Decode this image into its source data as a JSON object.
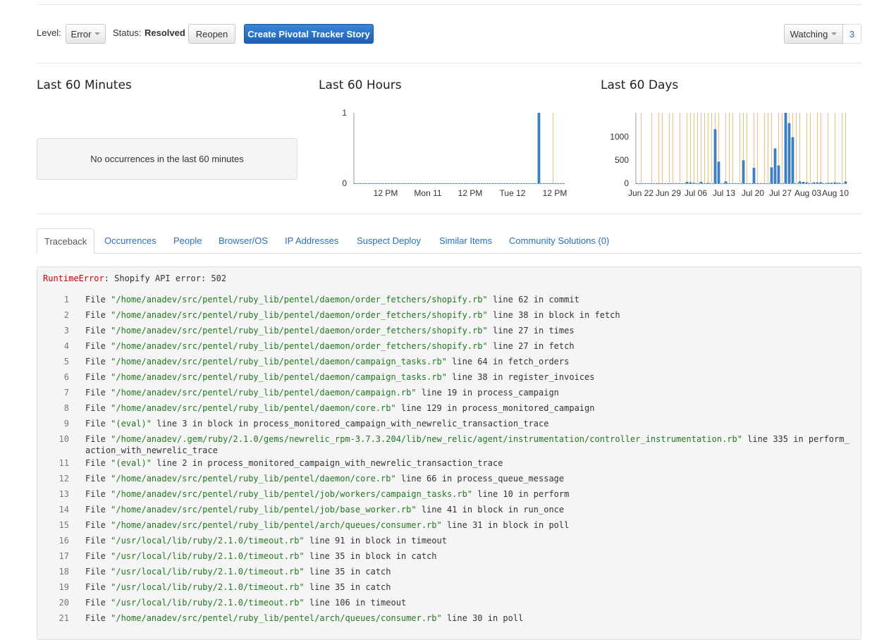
{
  "toolbar": {
    "level_label": "Level:",
    "level_value": "Error",
    "status_label": "Status:",
    "status_value": "Resolved",
    "reopen_label": "Reopen",
    "pivotal_label": "Create Pivotal Tracker Story",
    "watching_label": "Watching",
    "watch_count": "3"
  },
  "charts": {
    "minutes": {
      "title": "Last 60 Minutes",
      "empty_text": "No occurrences in the last 60 minutes"
    },
    "hours": {
      "title": "Last 60 Hours",
      "y_ticks": [
        "1",
        "0"
      ],
      "x_ticks": [
        "12 PM",
        "Mon 11",
        "12 PM",
        "Tue 12",
        "12 PM"
      ]
    },
    "days": {
      "title": "Last 60 Days",
      "y_ticks": [
        "1000",
        "500",
        "0"
      ],
      "x_ticks": [
        "Jun 22",
        "Jun 29",
        "Jul 06",
        "Jul 13",
        "Jul 20",
        "Jul 27",
        "Aug 03",
        "Aug 10"
      ]
    }
  },
  "chart_data": [
    {
      "type": "bar",
      "title": "Last 60 Hours",
      "series": [
        {
          "values": [
            0,
            0,
            0,
            0,
            0,
            0,
            0,
            0,
            0,
            0,
            0,
            0,
            0,
            0,
            0,
            0,
            0,
            0,
            0,
            0,
            0,
            0,
            0,
            0,
            0,
            0,
            0,
            0,
            0,
            0,
            0,
            0,
            0,
            0,
            0,
            0,
            0,
            0,
            0,
            0,
            0,
            0,
            0,
            0,
            0,
            0,
            0,
            0,
            0,
            0,
            0,
            0,
            1,
            0,
            0,
            0,
            0,
            0,
            0,
            0
          ]
        }
      ],
      "ylim": [
        0,
        1
      ],
      "deploy_marker_index": 56,
      "bar_color": "#3f7fbf",
      "marker_color": "#f0c27a"
    },
    {
      "type": "bar",
      "title": "Last 60 Days",
      "x_start": "Jun 20",
      "series": [
        {
          "values": [
            0,
            0,
            0,
            0,
            0,
            0,
            0,
            0,
            0,
            0,
            0,
            0,
            0,
            0,
            30,
            20,
            10,
            0,
            30,
            0,
            10,
            0,
            1150,
            460,
            0,
            40,
            0,
            0,
            0,
            0,
            490,
            0,
            0,
            330,
            0,
            0,
            0,
            0,
            340,
            740,
            380,
            0,
            1550,
            1280,
            980,
            0,
            40,
            30,
            20,
            0,
            20,
            20,
            20,
            0,
            10,
            10,
            20,
            10,
            0,
            40
          ]
        }
      ],
      "ylim": [
        0,
        1500
      ],
      "deploy_marker_indices": [
        1,
        4,
        6,
        7,
        9,
        10,
        12,
        14,
        15,
        16,
        17,
        18,
        19,
        20,
        21,
        22,
        23,
        25,
        26,
        27,
        29,
        30,
        31,
        33,
        34,
        36,
        37,
        38,
        40,
        41,
        42,
        43,
        44,
        45,
        46,
        48,
        49,
        51,
        52,
        54,
        56,
        58,
        59
      ],
      "bar_color": "#3f7fbf",
      "marker_color": "#f0c27a"
    }
  ],
  "tabs": [
    {
      "label": "Traceback",
      "active": true
    },
    {
      "label": "Occurrences"
    },
    {
      "label": "People"
    },
    {
      "label": "Browser/OS"
    },
    {
      "label": "IP Addresses"
    },
    {
      "label": "Suspect Deploy"
    },
    {
      "label": "Similar Items"
    },
    {
      "label": "Community Solutions (0)"
    }
  ],
  "traceback": {
    "error_type": "RuntimeError",
    "error_message": ": Shopify API error: 502",
    "frames": [
      {
        "num": "1",
        "path": "\"/home/anadev/src/pentel/ruby_lib/pentel/daemon/order_fetchers/shopify.rb\"",
        "rest": " line 62 in commit"
      },
      {
        "num": "2",
        "path": "\"/home/anadev/src/pentel/ruby_lib/pentel/daemon/order_fetchers/shopify.rb\"",
        "rest": " line 38 in block in fetch"
      },
      {
        "num": "3",
        "path": "\"/home/anadev/src/pentel/ruby_lib/pentel/daemon/order_fetchers/shopify.rb\"",
        "rest": " line 27 in times"
      },
      {
        "num": "4",
        "path": "\"/home/anadev/src/pentel/ruby_lib/pentel/daemon/order_fetchers/shopify.rb\"",
        "rest": " line 27 in fetch"
      },
      {
        "num": "5",
        "path": "\"/home/anadev/src/pentel/ruby_lib/pentel/daemon/campaign_tasks.rb\"",
        "rest": " line 64 in fetch_orders"
      },
      {
        "num": "6",
        "path": "\"/home/anadev/src/pentel/ruby_lib/pentel/daemon/campaign_tasks.rb\"",
        "rest": " line 38 in register_invoices"
      },
      {
        "num": "7",
        "path": "\"/home/anadev/src/pentel/ruby_lib/pentel/daemon/campaign.rb\"",
        "rest": " line 19 in process_campaign"
      },
      {
        "num": "8",
        "path": "\"/home/anadev/src/pentel/ruby_lib/pentel/daemon/core.rb\"",
        "rest": " line 129 in process_monitored_campaign"
      },
      {
        "num": "9",
        "path": "\"(eval)\"",
        "rest": " line 3 in block in process_monitored_campaign_with_newrelic_transaction_trace"
      },
      {
        "num": "10",
        "path": "\"/home/anadev/.gem/ruby/2.1.0/gems/newrelic_rpm-3.7.3.204/lib/new_relic/agent/instrumentation/controller_instrumentation.rb\"",
        "rest": " line 335 in perform_action_with_newrelic_trace"
      },
      {
        "num": "11",
        "path": "\"(eval)\"",
        "rest": " line 2 in process_monitored_campaign_with_newrelic_transaction_trace"
      },
      {
        "num": "12",
        "path": "\"/home/anadev/src/pentel/ruby_lib/pentel/daemon/core.rb\"",
        "rest": " line 66 in process_queue_message"
      },
      {
        "num": "13",
        "path": "\"/home/anadev/src/pentel/ruby_lib/pentel/job/workers/campaign_tasks.rb\"",
        "rest": " line 10 in perform"
      },
      {
        "num": "14",
        "path": "\"/home/anadev/src/pentel/ruby_lib/pentel/job/base_worker.rb\"",
        "rest": " line 41 in block in run_once"
      },
      {
        "num": "15",
        "path": "\"/home/anadev/src/pentel/ruby_lib/pentel/arch/queues/consumer.rb\"",
        "rest": " line 31 in block in poll"
      },
      {
        "num": "16",
        "path": "\"/usr/local/lib/ruby/2.1.0/timeout.rb\"",
        "rest": " line 91 in block in timeout"
      },
      {
        "num": "17",
        "path": "\"/usr/local/lib/ruby/2.1.0/timeout.rb\"",
        "rest": " line 35 in block in catch"
      },
      {
        "num": "18",
        "path": "\"/usr/local/lib/ruby/2.1.0/timeout.rb\"",
        "rest": " line 35 in catch"
      },
      {
        "num": "19",
        "path": "\"/usr/local/lib/ruby/2.1.0/timeout.rb\"",
        "rest": " line 35 in catch"
      },
      {
        "num": "20",
        "path": "\"/usr/local/lib/ruby/2.1.0/timeout.rb\"",
        "rest": " line 106 in timeout"
      },
      {
        "num": "21",
        "path": "\"/home/anadev/src/pentel/ruby_lib/pentel/arch/queues/consumer.rb\"",
        "rest": " line 30 in poll"
      }
    ],
    "file_word": "File "
  }
}
